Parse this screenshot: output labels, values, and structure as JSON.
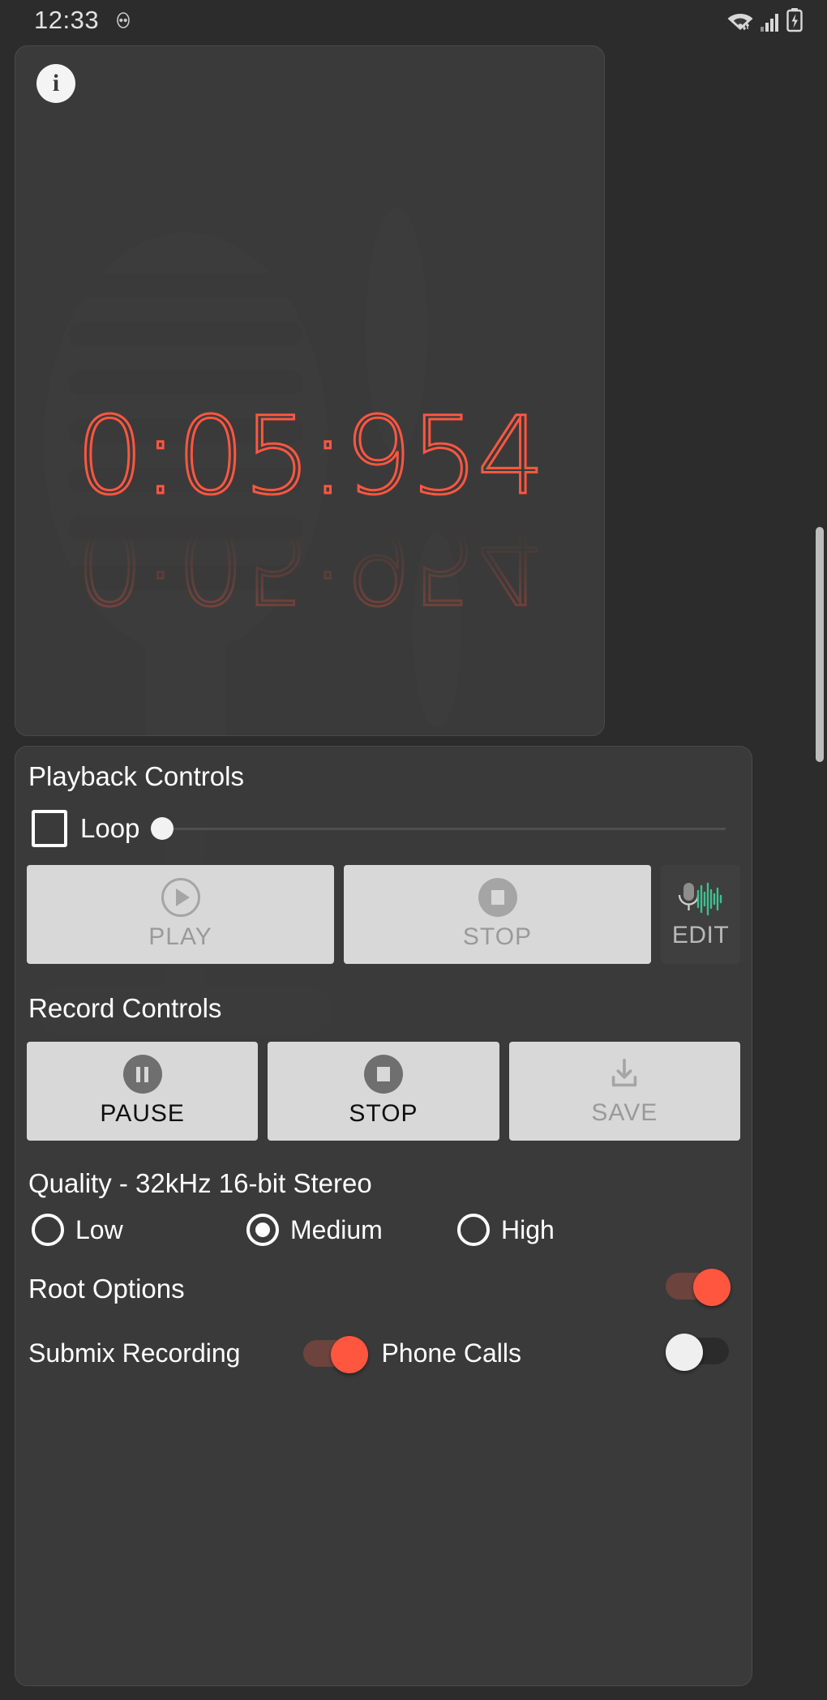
{
  "statusbar": {
    "clock": "12:33",
    "icons": [
      "eye-icon",
      "wifi-icon",
      "cellular-signal-icon",
      "battery-charging-icon"
    ]
  },
  "timer_card": {
    "info_button_label": "i",
    "elapsed": "0:05:954",
    "background_image": "microphone-illustration"
  },
  "playback": {
    "title": "Playback Controls",
    "loop_label": "Loop",
    "loop_checked": false,
    "slider_value": 0,
    "buttons": [
      {
        "label": "PLAY",
        "icon": "play-circle-icon",
        "enabled": false
      },
      {
        "label": "STOP",
        "icon": "stop-circle-icon",
        "enabled": false
      }
    ],
    "edit_button": {
      "label": "EDIT",
      "icon": "microphone-waveform-icon",
      "enabled": true
    }
  },
  "record": {
    "title": "Record Controls",
    "buttons": [
      {
        "label": "PAUSE",
        "icon": "pause-circle-icon",
        "enabled": true
      },
      {
        "label": "STOP",
        "icon": "stop-circle-icon",
        "enabled": true
      },
      {
        "label": "SAVE",
        "icon": "download-icon",
        "enabled": false
      }
    ]
  },
  "quality": {
    "title": "Quality - 32kHz 16-bit Stereo",
    "options": [
      {
        "label": "Low",
        "selected": false
      },
      {
        "label": "Medium",
        "selected": true
      },
      {
        "label": "High",
        "selected": false
      }
    ]
  },
  "root_options": {
    "title": "Root Options",
    "enabled": true,
    "submix_label": "Submix Recording",
    "submix_enabled": true,
    "phone_calls_label": "Phone Calls",
    "phone_calls_enabled": false
  },
  "colors": {
    "accent_red": "#ff5640",
    "card_bg": "#3a3a3a",
    "page_bg": "#2c2c2c",
    "button_face": "#d8d8d8",
    "waveform_green": "#3fbf8f"
  }
}
